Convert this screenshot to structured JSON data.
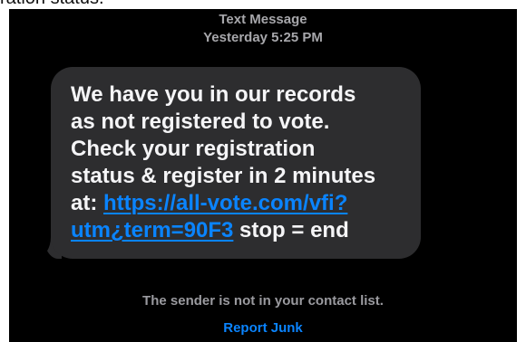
{
  "caption": {
    "partial_text": "ration status."
  },
  "thread": {
    "kind": "Text Message",
    "timestamp": "Yesterday 5:25 PM"
  },
  "message": {
    "line1": "We have you in our records",
    "line2": "as not registered to vote.",
    "line3": "Check your registration",
    "line4": "status & register in 2 minutes",
    "line5_prefix": "at: ",
    "link_part1": "https://all-vote.com/vfi?",
    "link_part2": "utm¿term=90F3",
    "line6_suffix": " stop = end"
  },
  "footer": {
    "notice": "The sender is not in your contact list.",
    "report_label": "Report Junk"
  },
  "colors": {
    "background": "#000000",
    "bubble": "#2d2d2f",
    "link": "#0a84ff",
    "muted_text": "#9a9a9f"
  }
}
